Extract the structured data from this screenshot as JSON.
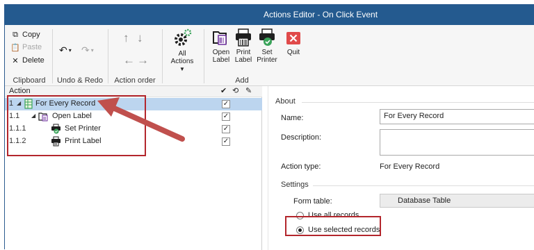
{
  "window": {
    "title": "Actions Editor - On Click Event"
  },
  "ribbon": {
    "clipboard": {
      "copy": "Copy",
      "paste": "Paste",
      "delete": "Delete",
      "label": "Clipboard"
    },
    "undo_redo": {
      "label": "Undo & Redo"
    },
    "action_order": {
      "label": "Action order"
    },
    "all_actions": {
      "line1": "All",
      "line2": "Actions"
    },
    "add": {
      "label": "Add",
      "open_label": {
        "line1": "Open",
        "line2": "Label"
      },
      "print_label": {
        "line1": "Print",
        "line2": "Label"
      },
      "set_printer": {
        "line1": "Set",
        "line2": "Printer"
      },
      "quit": "Quit"
    }
  },
  "actions_grid": {
    "header": "Action",
    "rows": [
      {
        "num": "1",
        "label": "For Every Record",
        "checked": "✓",
        "icon": "database-table-icon"
      },
      {
        "num": "1.1",
        "label": "Open Label",
        "checked": "✓",
        "icon": "open-label-icon"
      },
      {
        "num": "1.1.1",
        "label": "Set Printer",
        "checked": "✓",
        "icon": "set-printer-icon"
      },
      {
        "num": "1.1.2",
        "label": "Print Label",
        "checked": "✓",
        "icon": "print-label-icon"
      }
    ]
  },
  "properties": {
    "about_section": "About",
    "name_label": "Name:",
    "name_value": "For Every Record",
    "description_label": "Description:",
    "description_value": "",
    "action_type_label": "Action type:",
    "action_type_value": "For Every Record",
    "settings_section": "Settings",
    "form_table_label": "Form table:",
    "form_table_value": "Database Table",
    "radio_all": "Use all records",
    "radio_selected": "Use selected records"
  },
  "colors": {
    "titlebar": "#245a8f",
    "selection": "#bcd5ef",
    "annotation_red": "#b3262c",
    "quit_red": "#e04a4a",
    "gear_green": "#3aa35a"
  }
}
